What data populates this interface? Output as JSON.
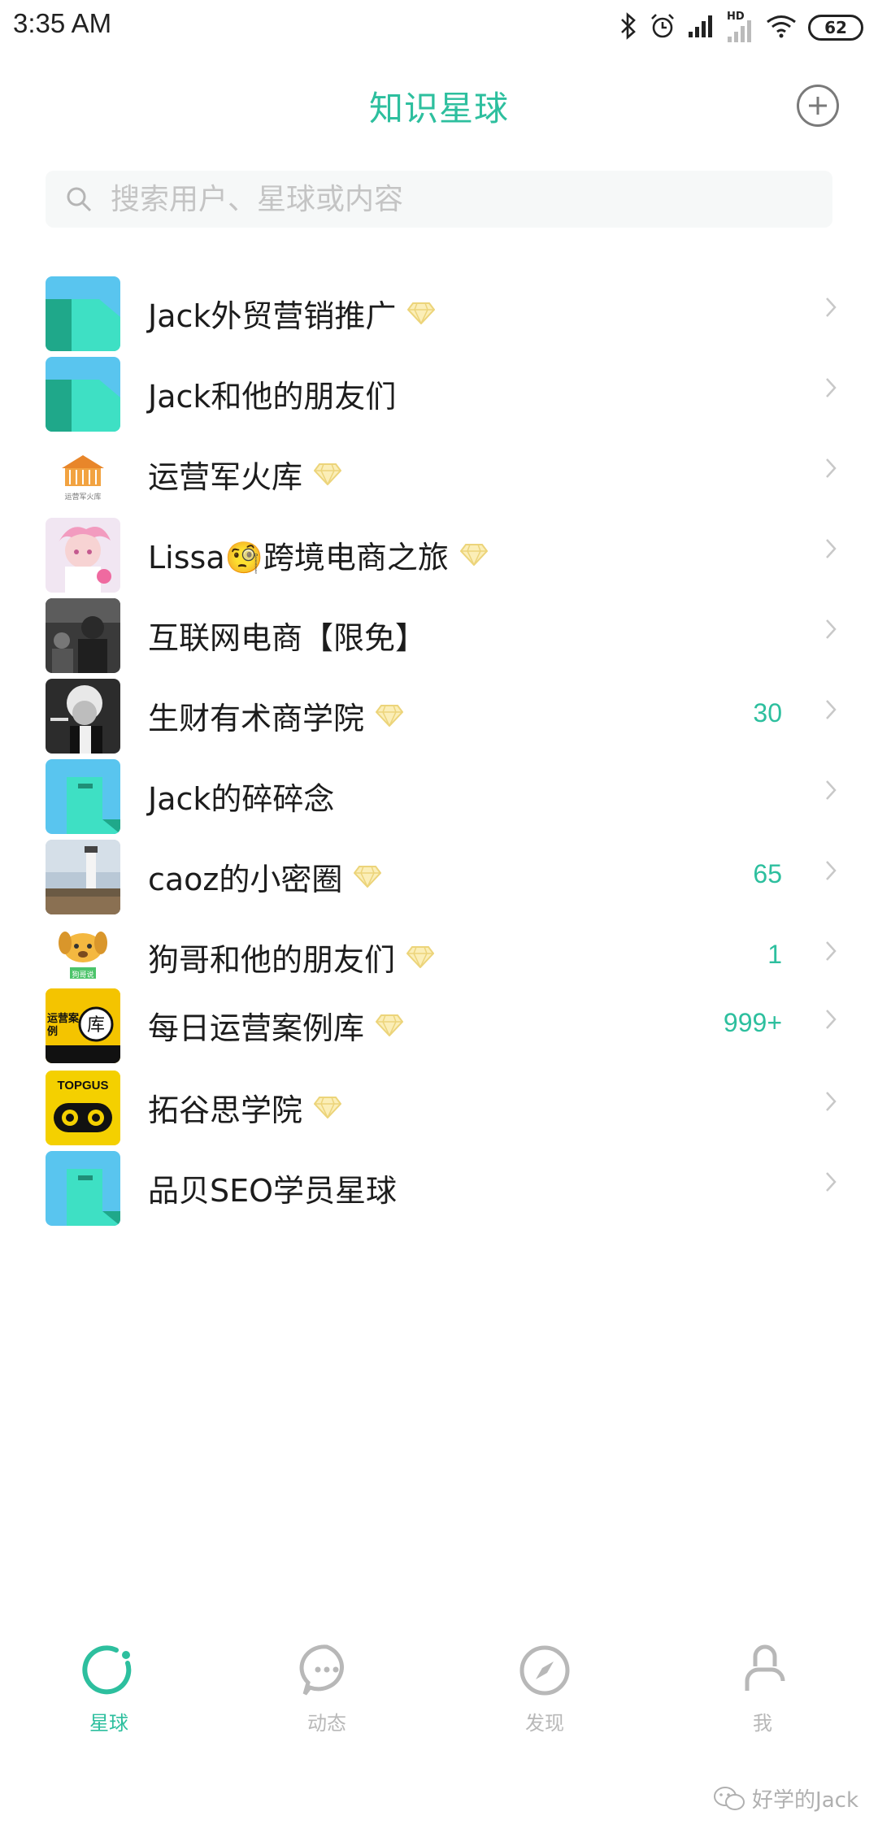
{
  "status_bar": {
    "time": "3:35 AM",
    "network_label": "HD",
    "battery": "62"
  },
  "header": {
    "title": "知识星球",
    "add_icon": "plus-circle-icon"
  },
  "search": {
    "placeholder": "搜索用户、星球或内容",
    "value": ""
  },
  "groups": [
    {
      "name": "Jack外贸营销推广",
      "premium": true,
      "count": "",
      "avatar": "teal-blue-block"
    },
    {
      "name": "Jack和他的朋友们",
      "premium": false,
      "count": "",
      "avatar": "teal-blue-block"
    },
    {
      "name": "运营军火库",
      "premium": true,
      "count": "",
      "avatar": "warehouse-logo",
      "avatar_caption": "运营军火库"
    },
    {
      "name": "Lissa🧐跨境电商之旅",
      "premium": true,
      "count": "",
      "avatar": "anime-girl"
    },
    {
      "name": "互联网电商【限免】",
      "premium": false,
      "count": "",
      "avatar": "dark-photo"
    },
    {
      "name": "生财有术商学院",
      "premium": true,
      "count": "30",
      "avatar": "bw-portrait"
    },
    {
      "name": "Jack的碎碎念",
      "premium": false,
      "count": "",
      "avatar": "teal-tile-block"
    },
    {
      "name": "caoz的小密圈",
      "premium": true,
      "count": "65",
      "avatar": "lighthouse-photo"
    },
    {
      "name": "狗哥和他的朋友们",
      "premium": true,
      "count": "1",
      "avatar": "cartoon-dog",
      "avatar_caption": "狗哥说"
    },
    {
      "name": "每日运营案例库",
      "premium": true,
      "count": "999+",
      "avatar": "yellow-library-logo",
      "avatar_caption": "运营案例"
    },
    {
      "name": "拓谷思学院",
      "premium": true,
      "count": "",
      "avatar": "owl-logo",
      "avatar_caption": "TOPGUS"
    },
    {
      "name": "品贝SEO学员星球",
      "premium": false,
      "count": "",
      "avatar": "teal-tile-block"
    }
  ],
  "tabs": [
    {
      "label": "星球",
      "icon": "planet-icon",
      "active": true
    },
    {
      "label": "动态",
      "icon": "chat-bubble-icon",
      "active": false
    },
    {
      "label": "发现",
      "icon": "compass-icon",
      "active": false
    },
    {
      "label": "我",
      "icon": "person-icon",
      "active": false
    }
  ],
  "watermark": "好学的Jack",
  "colors": {
    "accent": "#2dbf9e",
    "diamond": "#f2d77a",
    "text": "#1c1c1c",
    "inactive": "#b8b8b8"
  }
}
